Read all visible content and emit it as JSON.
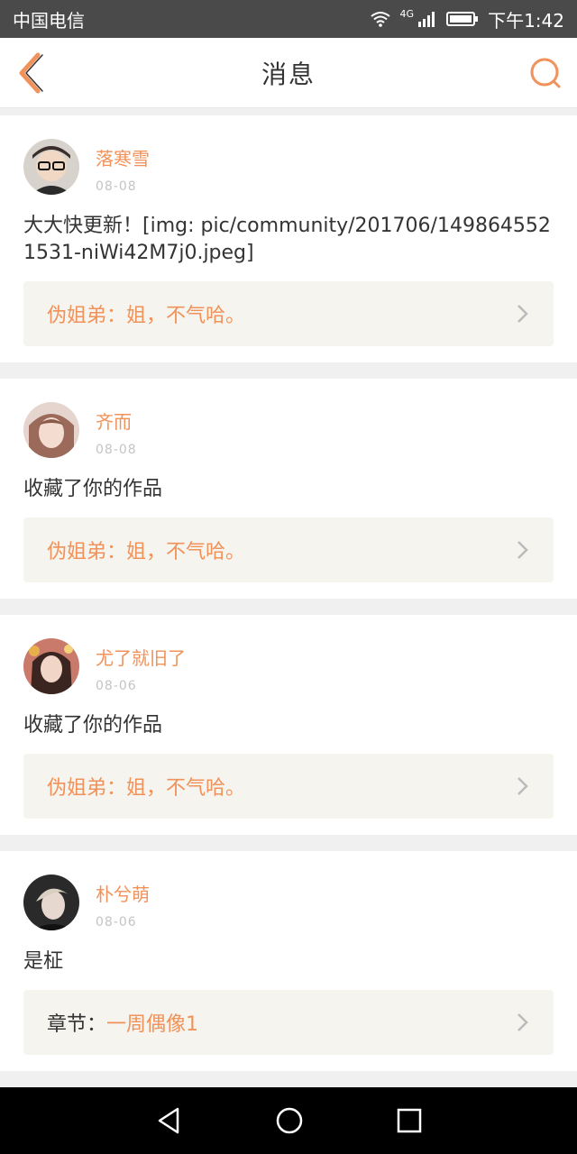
{
  "status": {
    "carrier": "中国电信",
    "network": "4G",
    "time": "下午1:42"
  },
  "header": {
    "title": "消息",
    "back_icon": "chevron-left-icon",
    "search_icon": "search-icon",
    "accent": "#f0925a"
  },
  "messages": [
    {
      "username": "落寒雪",
      "date": "08-08",
      "text": "大大快更新！[img: pic/community/201706/1498645521531-niWi42M7j0.jpeg]",
      "reply_label": "伪姐弟：",
      "reply_text": "姐，不气哈。"
    },
    {
      "username": "齐而",
      "date": "08-08",
      "text": "收藏了你的作品",
      "reply_label": "伪姐弟：",
      "reply_text": "姐，不气哈。"
    },
    {
      "username": "尤了就旧了",
      "date": "08-06",
      "text": "收藏了你的作品",
      "reply_label": "伪姐弟：",
      "reply_text": "姐，不气哈。"
    },
    {
      "username": "朴兮萌",
      "date": "08-06",
      "text": "是柾",
      "reply_label": "章节：",
      "reply_text": "一周偶像1"
    }
  ]
}
